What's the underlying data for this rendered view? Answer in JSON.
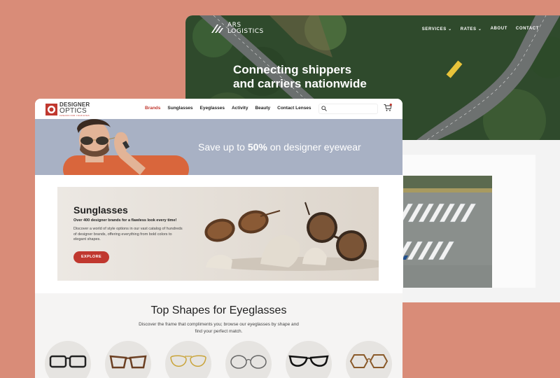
{
  "ars": {
    "logo_line1": "ARS",
    "logo_line2": "LOGISTICS",
    "nav": [
      "SERVICES",
      "RATES",
      "ABOUT",
      "CONTACT"
    ],
    "nav_chevrons": [
      "chevron-down-icon",
      "chevron-down-icon"
    ],
    "headline_line1": "Connecting shippers",
    "headline_line2": "and carriers nationwide"
  },
  "designer_optics": {
    "logo_line1": "DESIGNER",
    "logo_line2": "OPTICS",
    "logo_tagline": "FASHION FOR YOUR EYES",
    "nav": [
      "Brands",
      "Sunglasses",
      "Eyeglasses",
      "Activity",
      "Beauty",
      "Contact Lenses"
    ],
    "nav_active": "Brands",
    "search": {
      "placeholder": "",
      "icon": "search-icon"
    },
    "cart_icon": "cart-icon",
    "banner": {
      "text_prefix": "Save up to ",
      "text_bold": "50%",
      "text_suffix": " on designer eyewear"
    },
    "feature": {
      "title": "Sunglasses",
      "subtitle": "Over 400 designer brands for a flawless look every time!",
      "body": "Discover a world of style options in our vast catalog of hundreds of designer brands, offering everything from bold colors to elegant shapes.",
      "button": "EXPLORE"
    },
    "shapes": {
      "title": "Top Shapes for Eyeglasses",
      "subtitle": "Discover the frame that compliments you; browse our eyeglasses by shape and find your perfect match."
    }
  },
  "colors": {
    "background": "#d98c78",
    "brand_red": "#c0382f",
    "banner": "#a8b1c4"
  }
}
